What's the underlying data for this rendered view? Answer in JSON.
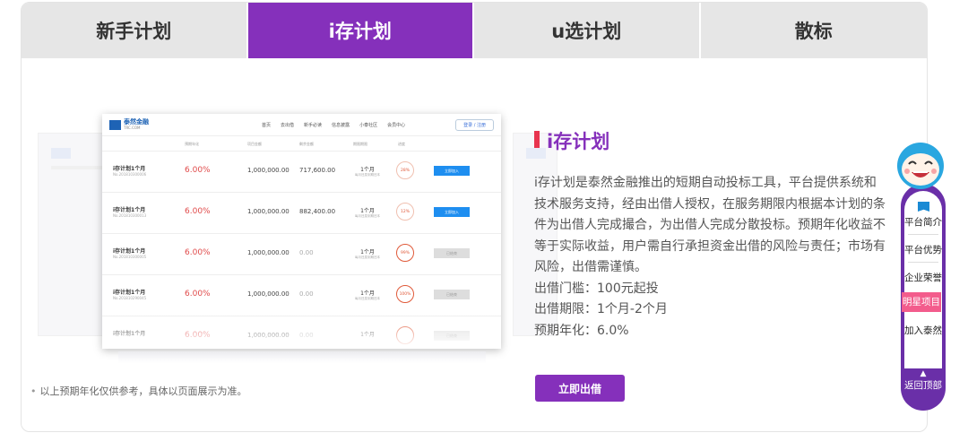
{
  "tabs": [
    {
      "label": "新手计划",
      "active": false
    },
    {
      "label": "i存计划",
      "active": true
    },
    {
      "label": "u选计划",
      "active": false
    },
    {
      "label": "散标",
      "active": false
    }
  ],
  "colors": {
    "accent": "#8530bb",
    "title_bar": "#e8344e",
    "tab_inactive": "#e6e6e6",
    "highlight": "#f35c8c"
  },
  "illustration": {
    "logo_name": "泰然金融",
    "logo_sub": "TRC.COM",
    "nav": [
      "首页",
      "去出借",
      "新手必读",
      "信息披露",
      "小泰社区",
      "会员中心"
    ],
    "login": "登录 / 注册",
    "columns": [
      "预期年化",
      "项目金额",
      "剩余金额",
      "期限期限",
      "进度"
    ],
    "rows": [
      {
        "name": "i存计划1个月",
        "no": "No.201810300006",
        "rate": "6.00%",
        "amount": "1,000,000.00",
        "remain": "717,600.00",
        "period": "1个月",
        "period_note": "每月还息到期还本",
        "progress": "28%",
        "action": "立即加入",
        "done": false
      },
      {
        "name": "i存计划1个月",
        "no": "No.201810300013",
        "rate": "6.00%",
        "amount": "1,000,000.00",
        "remain": "882,400.00",
        "period": "1个月",
        "period_note": "每月还息到期还本",
        "progress": "12%",
        "action": "立即加入",
        "done": false
      },
      {
        "name": "i存计划1个月",
        "no": "No.201810300005",
        "rate": "6.00%",
        "amount": "1,000,000.00",
        "remain": "0.00",
        "period": "1个月",
        "period_note": "每月还息到期还本",
        "progress": "99%",
        "action": "已结束",
        "done": true
      },
      {
        "name": "i存计划1个月",
        "no": "No.201810290045",
        "rate": "6.00%",
        "amount": "1,000,000.00",
        "remain": "0.00",
        "period": "1个月",
        "period_note": "每月还息到期还本",
        "progress": "100%",
        "action": "已结束",
        "done": true
      },
      {
        "name": "i存计划1个月",
        "no": "",
        "rate": "6.00%",
        "amount": "1,000,000.00",
        "remain": "0.00",
        "period": "1个月",
        "period_note": "",
        "progress": "",
        "action": "已结束",
        "done": true
      }
    ]
  },
  "note": "以上预期年化仅供参考，具体以页面展示为准。",
  "section": {
    "title": "i存计划",
    "description": "i存计划是泰然金融推出的短期自动投标工具，平台提供系统和技术服务支持，经由出借人授权，在服务期限内根据本计划的条件为出借人完成撮合，为出借人完成分散投标。预期年化收益不等于实际收益，用户需自行承担资金出借的风险与责任；市场有风险，出借需谨慎。",
    "threshold": "出借门槛：100元起投",
    "term": "出借期限：1个月-2个月",
    "rate": "预期年化：6.0%",
    "button": "立即出借"
  },
  "float_menu": {
    "items": [
      "平台简介",
      "平台优势",
      "企业荣誉",
      "明星项目",
      "加入泰然"
    ],
    "highlighted": "明星项目",
    "back_top": "返回顶部",
    "mascot": "smiling-mascot-icon"
  }
}
